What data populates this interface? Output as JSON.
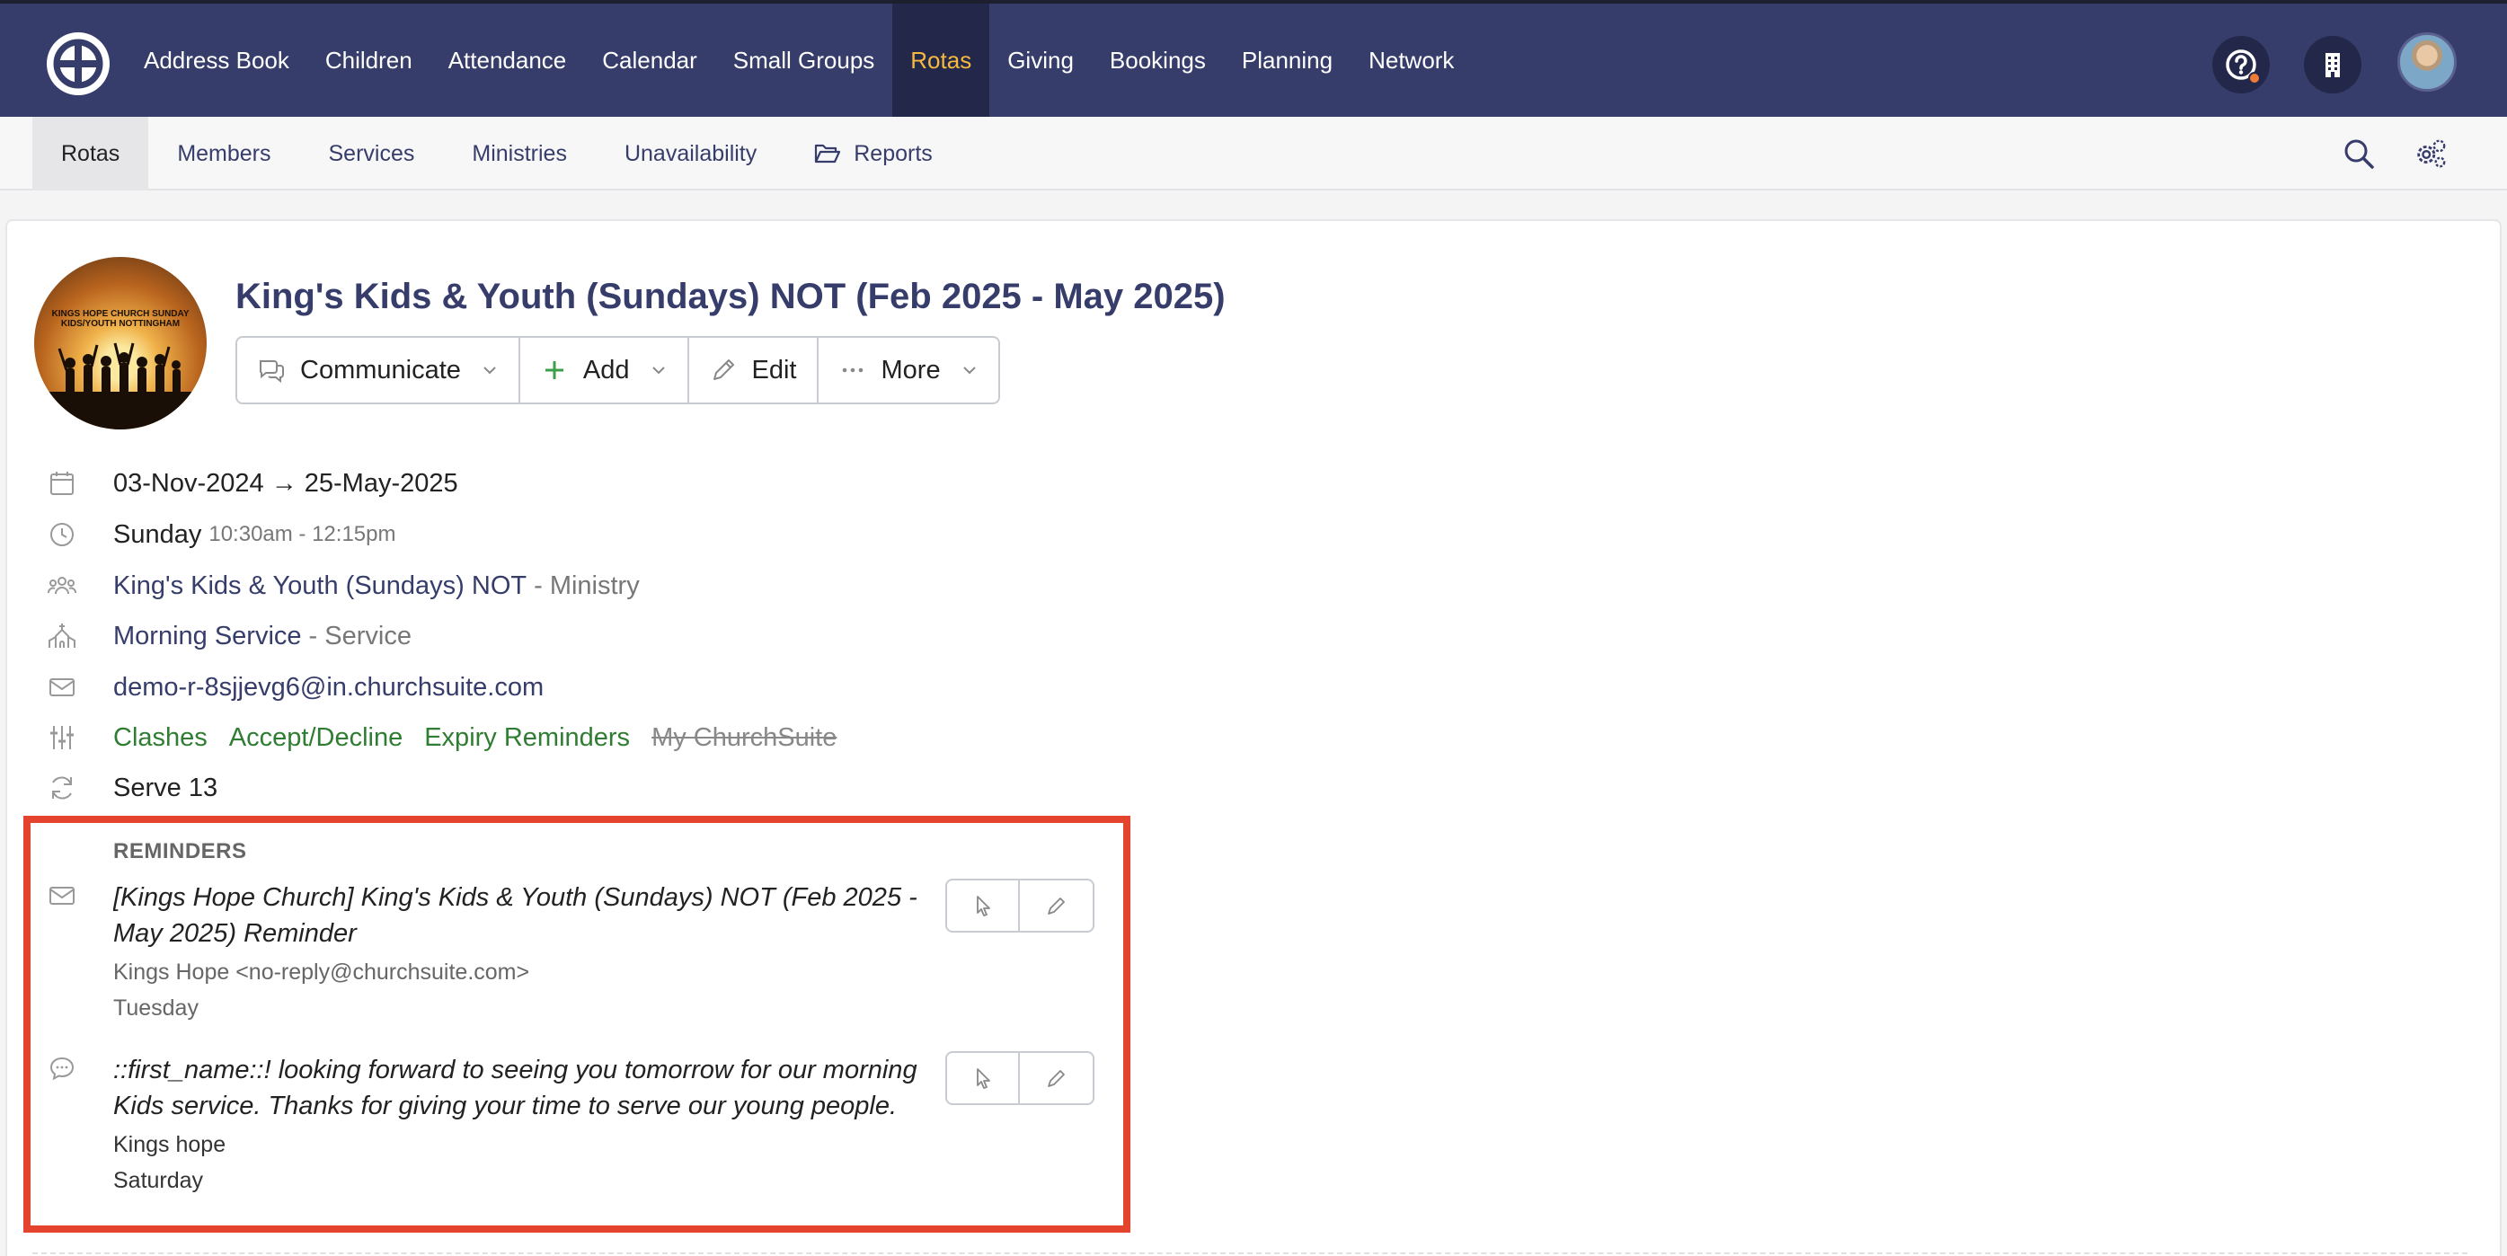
{
  "topnav": {
    "items": [
      "Address Book",
      "Children",
      "Attendance",
      "Calendar",
      "Small Groups",
      "Rotas",
      "Giving",
      "Bookings",
      "Planning",
      "Network"
    ],
    "active": "Rotas"
  },
  "subnav": {
    "items": [
      "Rotas",
      "Members",
      "Services",
      "Ministries",
      "Unavailability",
      "Reports"
    ],
    "active": "Rotas"
  },
  "rota": {
    "image_text": "KINGS HOPE CHURCH SUNDAY KIDS/YOUTH NOTTINGHAM",
    "title": "King's Kids & Youth (Sundays) NOT (Feb 2025 - May 2025)",
    "actions": {
      "communicate": "Communicate",
      "add": "Add",
      "edit": "Edit",
      "more": "More"
    },
    "dates": "03-Nov-2024 → 25-May-2025",
    "day": "Sunday",
    "time": "10:30am - 12:15pm",
    "ministry_link": "King's Kids & Youth (Sundays) NOT",
    "ministry_suffix": "- Ministry",
    "service_link": "Morning Service",
    "service_suffix": "- Service",
    "email": "demo-r-8sjjevg6@in.churchsuite.com",
    "settings": {
      "clashes": "Clashes",
      "accept_decline": "Accept/Decline",
      "expiry_reminders": "Expiry Reminders",
      "my_churchsuite": "My ChurchSuite"
    },
    "serve": "Serve 13"
  },
  "reminders": {
    "heading": "REMINDERS",
    "items": [
      {
        "type": "email",
        "subject": "[Kings Hope Church] King's Kids & Youth (Sundays) NOT (Feb 2025 - May 2025) Reminder",
        "from": "Kings Hope   <no-reply@churchsuite.com>",
        "when": "Tuesday"
      },
      {
        "type": "sms",
        "subject": "::first_name::! looking forward to seeing you tomorrow for our morning Kids service. Thanks for giving your time to serve our young people.",
        "from": "Kings hope",
        "when": "Saturday"
      }
    ]
  },
  "colors": {
    "nav_bg": "#373d6b",
    "nav_active_text": "#f4b93e",
    "link": "#373d6b",
    "green_setting": "#2f7d32",
    "highlight": "#e4432e"
  }
}
